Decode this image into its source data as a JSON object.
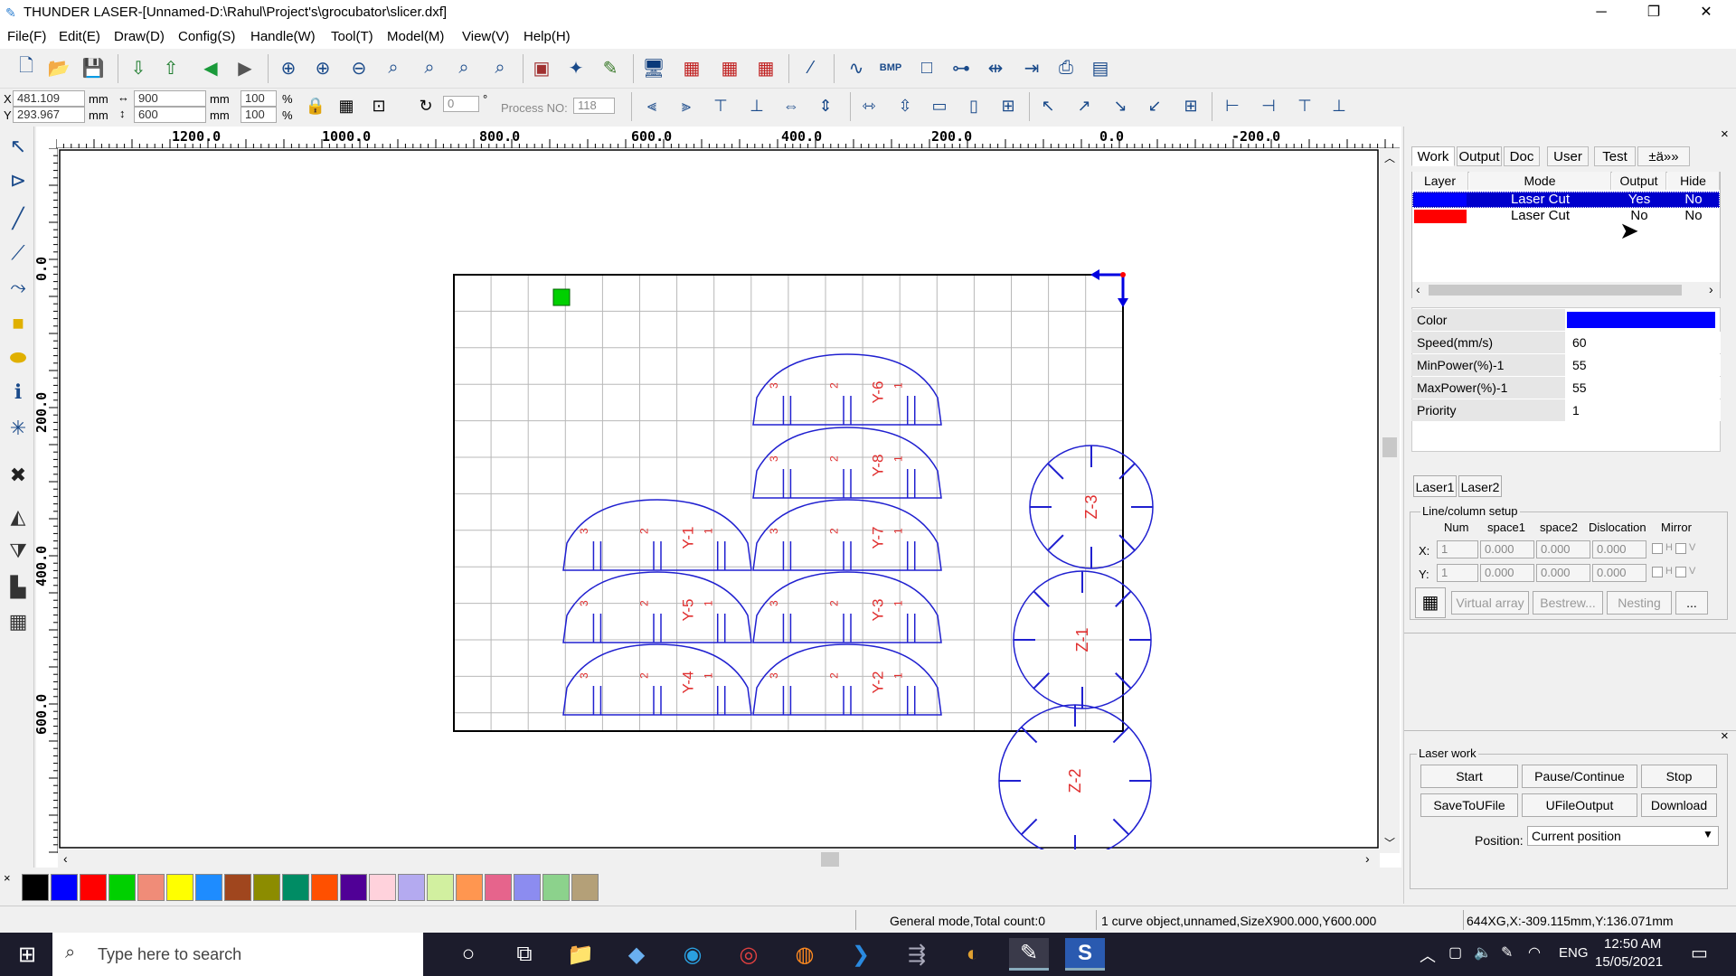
{
  "window": {
    "title": "THUNDER LASER-[Unnamed-D:\\Rahul\\Project's\\grocubator\\slicer.dxf]",
    "minimize": "─",
    "restore": "❐",
    "close": "✕"
  },
  "menu": [
    "File(F)",
    "Edit(E)",
    "Draw(D)",
    "Config(S)",
    "Handle(W)",
    "Tool(T)",
    "Model(M)",
    "View(V)",
    "Help(H)"
  ],
  "coords": {
    "x_label": "X",
    "y_label": "Y",
    "x": "481.109",
    "y": "293.967",
    "unit": "mm",
    "width": "900",
    "height": "600",
    "wpct": "100",
    "hpct": "100",
    "pct": "%",
    "angle": "0",
    "deg": "°",
    "process_label": "Process NO:",
    "process_no": "118"
  },
  "ruler": {
    "h": [
      "1200.0",
      "1000.0",
      "800.0",
      "600.0",
      "400.0",
      "200.0",
      "0.0",
      "-200.0"
    ],
    "v": [
      "0.0",
      "200.0",
      "400.0",
      "600.0"
    ]
  },
  "parts": {
    "half_labels": [
      "Y-6",
      "Y-8",
      "Y-1",
      "Y-7",
      "Y-5",
      "Y-3",
      "Y-4",
      "Y-2"
    ],
    "disc_labels": [
      "Z-3",
      "Z-1",
      "Z-2"
    ],
    "slot_numbers": [
      "3",
      "2",
      "1"
    ]
  },
  "palette": [
    "#000000",
    "#0000ff",
    "#ff0000",
    "#00d000",
    "#f08c78",
    "#ffff00",
    "#1e8cff",
    "#a0461e",
    "#8c8c00",
    "#008c64",
    "#ff5000",
    "#500096",
    "#ffd2dc",
    "#b4aaf0",
    "#d2f0a0",
    "#ff9650",
    "#e6648c",
    "#8c8cf0",
    "#8cd28c",
    "#b4a078"
  ],
  "palette_close": "×",
  "panel": {
    "close": "×",
    "tabs": [
      "Work",
      "Output",
      "Doc",
      "User",
      "Test",
      "±ä»»"
    ],
    "layer_headers": [
      "Layer",
      "Mode",
      "Output",
      "Hide"
    ],
    "layers": [
      {
        "color": "#0000ff",
        "mode": "Laser Cut",
        "output": "Yes",
        "hide": "No",
        "selected": true
      },
      {
        "color": "#ff0000",
        "mode": "Laser Cut",
        "output": "No",
        "hide": "No",
        "selected": false
      }
    ],
    "props": [
      {
        "label": "Color",
        "value": ""
      },
      {
        "label": "Speed(mm/s)",
        "value": "60"
      },
      {
        "label": "MinPower(%)-1",
        "value": "55"
      },
      {
        "label": "MaxPower(%)-1",
        "value": "55"
      },
      {
        "label": "Priority",
        "value": "1"
      }
    ],
    "color_value": "#0000ff",
    "laser_tabs": [
      "Laser1",
      "Laser2"
    ],
    "linecol": {
      "title": "Line/column setup",
      "headers": [
        "Num",
        "space1",
        "space2",
        "Dislocation",
        "Mirror"
      ],
      "x_label": "X:",
      "y_label": "Y:",
      "x": [
        "1",
        "0.000",
        "0.000",
        "0.000"
      ],
      "y": [
        "1",
        "0.000",
        "0.000",
        "0.000"
      ],
      "h": "H",
      "v": "V"
    },
    "array_buttons": [
      "Virtual array",
      "Bestrew...",
      "Nesting",
      "..."
    ],
    "laserwork": {
      "title": "Laser work",
      "buttons": [
        "Start",
        "Pause/Continue",
        "Stop",
        "SaveToUFile",
        "UFileOutput",
        "Download"
      ],
      "position_label": "Position:",
      "position_value": "Current position"
    }
  },
  "status": {
    "mode": "General mode,Total count:0",
    "selection": "1 curve object,unnamed,SizeX900.000,Y600.000",
    "cursor": "644XG,X:-309.115mm,Y:136.071mm"
  },
  "taskbar": {
    "search_placeholder": "Type here to search",
    "lang": "ENG",
    "time": "12:50 AM",
    "date": "15/05/2021"
  }
}
